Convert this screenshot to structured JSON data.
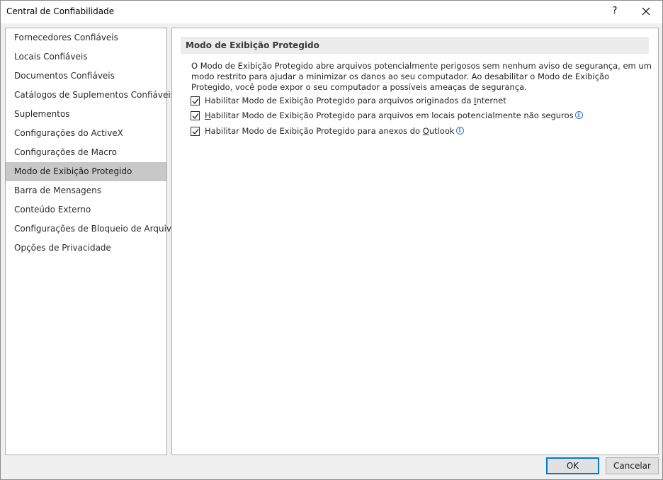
{
  "window": {
    "title": "Central de Confiabilidade",
    "help_label": "?"
  },
  "sidebar": {
    "items": [
      {
        "label": "Fornecedores Confiáveis",
        "selected": false
      },
      {
        "label": "Locais Confiáveis",
        "selected": false
      },
      {
        "label": "Documentos Confiáveis",
        "selected": false
      },
      {
        "label": "Catálogos de Suplementos Confiáveis",
        "selected": false
      },
      {
        "label": "Suplementos",
        "selected": false
      },
      {
        "label": "Configurações do ActiveX",
        "selected": false
      },
      {
        "label": "Configurações de Macro",
        "selected": false
      },
      {
        "label": "Modo de Exibição Protegido",
        "selected": true
      },
      {
        "label": "Barra de Mensagens",
        "selected": false
      },
      {
        "label": "Conteúdo Externo",
        "selected": false
      },
      {
        "label": "Configurações de Bloqueio de Arquivo",
        "selected": false
      },
      {
        "label": "Opções de Privacidade",
        "selected": false
      }
    ]
  },
  "main": {
    "section_title": "Modo de Exibição Protegido",
    "description": "O Modo de Exibição Protegido abre arquivos potencialmente perigosos sem nenhum aviso de segurança, em um modo restrito para ajudar a minimizar os danos ao seu computador. Ao desabilitar o Modo de Exibição Protegido, você pode expor o seu computador a possíveis ameaças de segurança.",
    "options": [
      {
        "pre": "Habilitar Modo de Exibição Protegido para arquivos originados da ",
        "accel": "I",
        "post": "nternet",
        "checked": true,
        "info": false
      },
      {
        "pre": "",
        "accel": "H",
        "post": "abilitar Modo de Exibição Protegido para arquivos em locais potencialmente não seguros",
        "checked": true,
        "info": true
      },
      {
        "pre": "Habilitar Modo de Exibição Protegido para anexos do ",
        "accel": "O",
        "post": "utlook",
        "checked": true,
        "info": true
      }
    ]
  },
  "footer": {
    "ok_label": "OK",
    "cancel_label": "Cancelar"
  },
  "icons": {
    "info": "info-icon",
    "close": "close-icon",
    "check": "checkmark-icon"
  },
  "colors": {
    "selected_bg": "#c8c8c8",
    "accent": "#0078d7",
    "info": "#2f6ecf"
  }
}
